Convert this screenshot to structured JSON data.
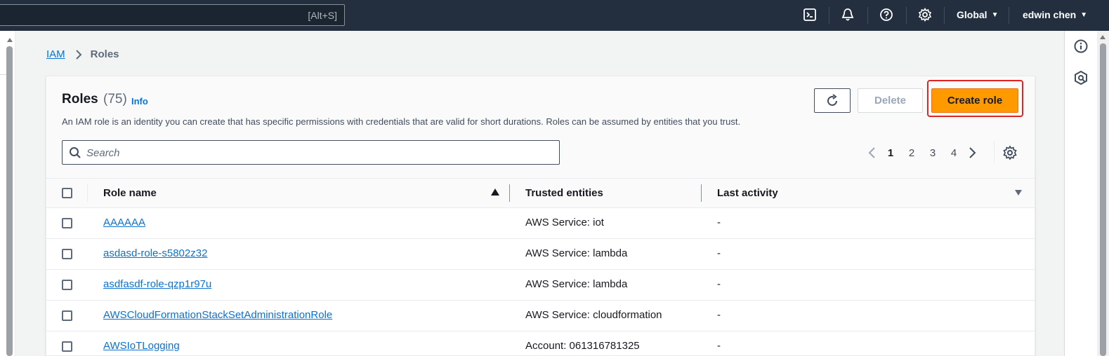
{
  "topbar": {
    "search_shortcut": "[Alt+S]",
    "region": "Global",
    "user": "edwin chen",
    "icons": [
      "cloudshell-icon",
      "notifications-icon",
      "help-icon",
      "settings-icon"
    ]
  },
  "breadcrumb": {
    "root": "IAM",
    "current": "Roles"
  },
  "header": {
    "title": "Roles",
    "count": "(75)",
    "info": "Info",
    "description": "An IAM role is an identity you can create that has specific permissions with credentials that are valid for short durations. Roles can be assumed by entities that you trust."
  },
  "actions": {
    "delete": "Delete",
    "create": "Create role"
  },
  "search": {
    "placeholder": "Search"
  },
  "pagination": {
    "pages": [
      "1",
      "2",
      "3",
      "4"
    ],
    "current": "1"
  },
  "table": {
    "columns": {
      "role_name": "Role name",
      "trusted_entities": "Trusted entities",
      "last_activity": "Last activity"
    },
    "rows": [
      {
        "name": "AAAAAA",
        "trusted": "AWS Service: iot",
        "activity": "-"
      },
      {
        "name": "asdasd-role-s5802z32",
        "trusted": "AWS Service: lambda",
        "activity": "-"
      },
      {
        "name": "asdfasdf-role-qzp1r97u",
        "trusted": "AWS Service: lambda",
        "activity": "-"
      },
      {
        "name": "AWSCloudFormationStackSetAdministrationRole",
        "trusted": "AWS Service: cloudformation",
        "activity": "-"
      },
      {
        "name": "AWSIoTLogging",
        "trusted": "Account: 061316781325",
        "activity": "-"
      }
    ]
  },
  "colors": {
    "topbar": "#232f3e",
    "primary_button": "#ff9900",
    "link": "#0972d3",
    "highlight": "#e02424"
  }
}
